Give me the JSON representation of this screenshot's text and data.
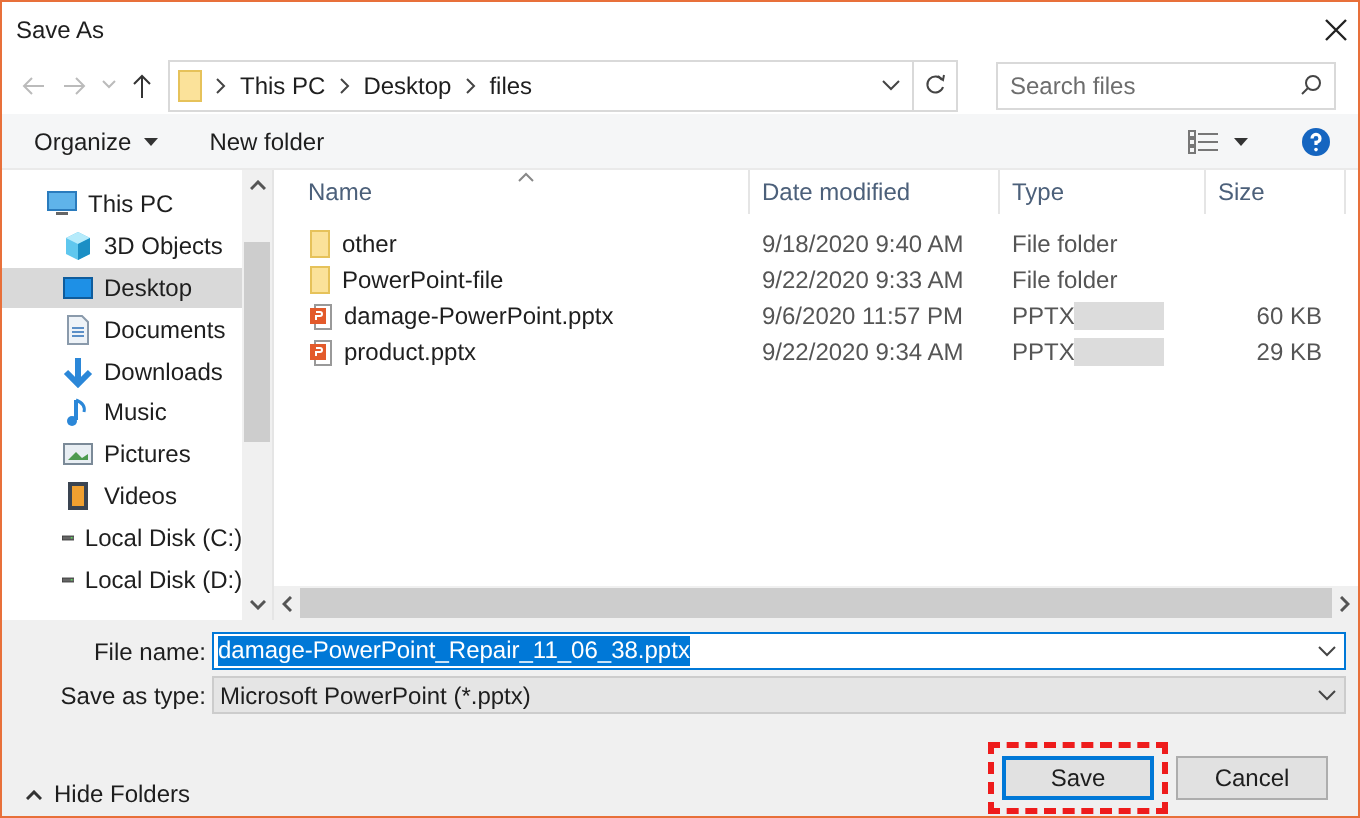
{
  "window": {
    "title": "Save As"
  },
  "address": {
    "crumbs": [
      "This PC",
      "Desktop",
      "files"
    ]
  },
  "search": {
    "placeholder": "Search files"
  },
  "toolbar": {
    "organize": "Organize",
    "new_folder": "New folder"
  },
  "sidebar": {
    "items": [
      {
        "label": "This PC",
        "kind": "pc",
        "selected": false
      },
      {
        "label": "3D Objects",
        "kind": "cube",
        "selected": false
      },
      {
        "label": "Desktop",
        "kind": "desktop",
        "selected": true
      },
      {
        "label": "Documents",
        "kind": "docs",
        "selected": false
      },
      {
        "label": "Downloads",
        "kind": "download",
        "selected": false
      },
      {
        "label": "Music",
        "kind": "music",
        "selected": false
      },
      {
        "label": "Pictures",
        "kind": "pictures",
        "selected": false
      },
      {
        "label": "Videos",
        "kind": "videos",
        "selected": false
      },
      {
        "label": "Local Disk (C:)",
        "kind": "disk",
        "selected": false
      },
      {
        "label": "Local Disk (D:)",
        "kind": "disk",
        "selected": false
      }
    ]
  },
  "table": {
    "columns": [
      "Name",
      "Date modified",
      "Type",
      "Size"
    ],
    "rows": [
      {
        "kind": "folder",
        "name": "other",
        "date": "9/18/2020 9:40 AM",
        "type": "File folder"
      },
      {
        "kind": "folder",
        "name": "PowerPoint-file",
        "date": "9/22/2020 9:33 AM",
        "type": "File folder"
      },
      {
        "kind": "pptx",
        "name": "damage-PowerPoint.pptx",
        "date": "9/6/2020 11:57 PM",
        "type": "PPTX",
        "size": "60 KB"
      },
      {
        "kind": "pptx",
        "name": "product.pptx",
        "date": "9/22/2020 9:34 AM",
        "type": "PPTX",
        "size": "29 KB"
      }
    ]
  },
  "file_name": {
    "label": "File name:",
    "value": "damage-PowerPoint_Repair_11_06_38.pptx"
  },
  "save_type": {
    "label": "Save as type:",
    "value": "Microsoft PowerPoint (*.pptx)"
  },
  "hide_folders": "Hide Folders",
  "buttons": {
    "save": "Save",
    "cancel": "Cancel"
  }
}
